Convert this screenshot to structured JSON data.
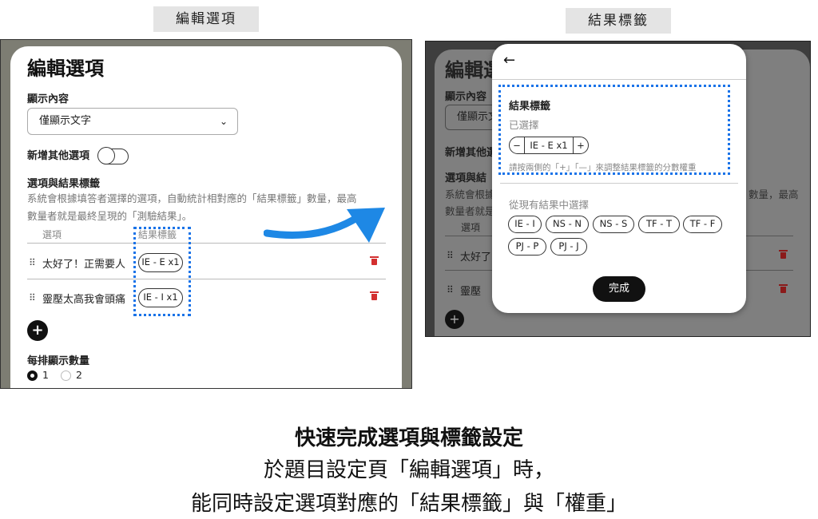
{
  "left_caption": "編輯選項",
  "right_caption": "結果標籤",
  "edit_panel": {
    "title": "編輯選項",
    "display_content_label": "顯示內容",
    "display_content_value": "僅顯示文字",
    "add_other_label": "新增其他選項",
    "options_section_label": "選項與結果標籤",
    "description_line1": "系統會根據填答者選擇的選項，自動統計相對應的「結果標籤」數量，最高",
    "description_line2": "數量者就是最終呈現的「測驗結果」。",
    "col_option": "選項",
    "col_tag": "結果標籤",
    "rows": [
      {
        "text": "太好了！正需要人",
        "tag": "IE - E x1"
      },
      {
        "text": "靈壓太高我會頭痛",
        "tag": "IE - I x1"
      }
    ],
    "add_symbol": "+",
    "per_row_label": "每排顯示數量",
    "radio_options": [
      "1",
      "2"
    ],
    "radio_selected": "1"
  },
  "tag_modal": {
    "back_icon": "arrow-left-icon",
    "section_title": "結果標籤",
    "selected_label": "已選擇",
    "stepper": {
      "minus": "−",
      "value": "IE - E x1",
      "plus": "+"
    },
    "hint": "請按兩側的「+」「—」來調整結果標籤的分數權重",
    "choose_label": "從現有結果中選擇",
    "tags_row1": [
      "IE - I",
      "NS - N",
      "NS - S",
      "TF - T",
      "TF - F"
    ],
    "tags_row2": [
      "PJ - P",
      "PJ - J"
    ],
    "done_label": "完成"
  },
  "background_dim": {
    "title": "編輯選",
    "display_content_label": "顯示內容",
    "display_value": "僅顯示文",
    "add_other_label": "新增其他選",
    "options_label": "選項與結",
    "desc_left1": "系統會根據",
    "desc_right1": "數量，最高",
    "desc_left2": "數量者就是",
    "col_option": "選項",
    "row1": "太好了",
    "row2": "靈壓",
    "add_symbol": "+"
  },
  "bottom": {
    "title": "快速完成選項與標籤設定",
    "line1": "於題目設定頁「編輯選項」時，",
    "line2": "能同時設定選項對應的「結果標籤」與「權重」"
  },
  "colors": {
    "accent_dotted": "#1a73e8",
    "arrow": "#1e88e5",
    "trash": "#d32f2f"
  }
}
